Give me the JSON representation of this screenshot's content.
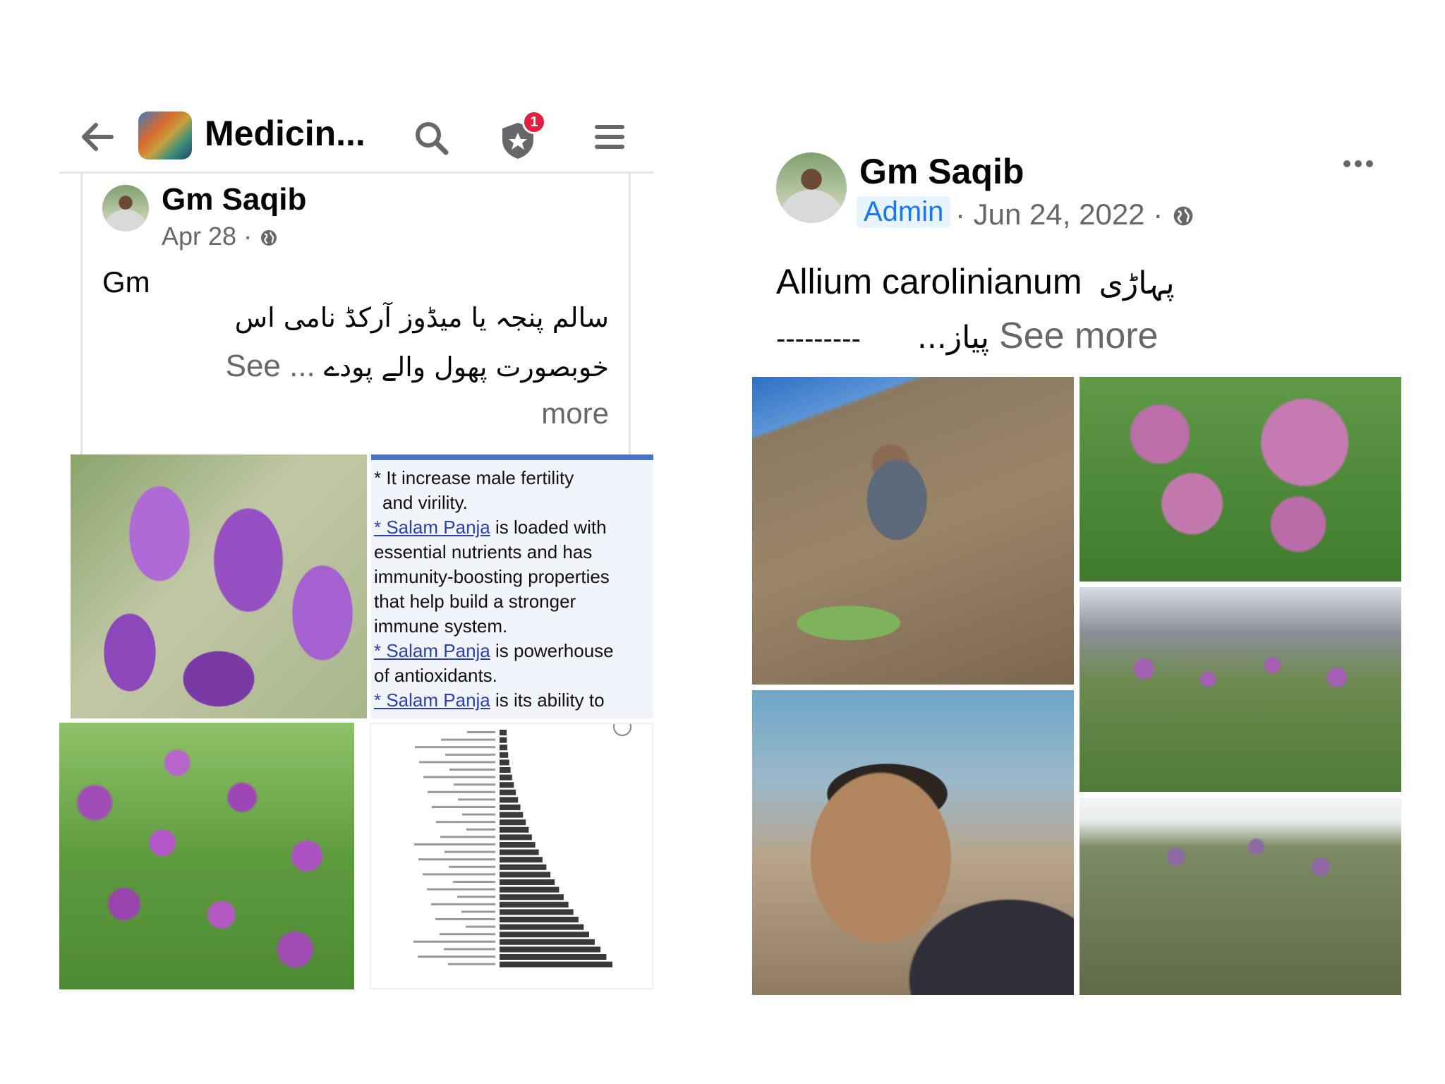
{
  "left_post": {
    "group_title": "Medicin...",
    "notification_count": "1",
    "author": "Gm Saqib",
    "date": "Apr 28 ·",
    "text_en": "Gm",
    "text_urdu_line1": "سالم پنجہ یا میڈوز آرکڈ نامی اس",
    "text_urdu_line2": "خوبصورت پھول والے پودے",
    "see_label": "See ...",
    "more_label": "more",
    "panel": {
      "line1": "* It increase male fertility",
      "line2": "and virility.",
      "link": "* Salam Panja",
      "l3_rest": " is loaded with",
      "line4": "essential nutrients and has",
      "line5": "immunity-boosting properties",
      "line6": "that help build a stronger",
      "line7": "immune system.",
      "l8_rest": " is powerhouse",
      "line9": "of antioxidants.",
      "l10_rest": " is its ability to"
    }
  },
  "right_post": {
    "author": "Gm Saqib",
    "badge": "Admin",
    "date": "· Jun 24, 2022 ·",
    "text_en": "Allium carolinianum",
    "text_urdu": "پہاڑی",
    "dashes": "---------",
    "text_urdu_2": "پیاز...",
    "see_more": "See more"
  },
  "colors": {
    "link": "#2a3fb5",
    "badge_bg": "#e7f3ff",
    "badge_text": "#1877f2",
    "notification": "#e41e3f",
    "meta": "#65676b"
  },
  "icons": [
    "back-arrow-icon",
    "search-icon",
    "shield-star-icon",
    "menu-icon",
    "globe-icon",
    "more-icon"
  ]
}
